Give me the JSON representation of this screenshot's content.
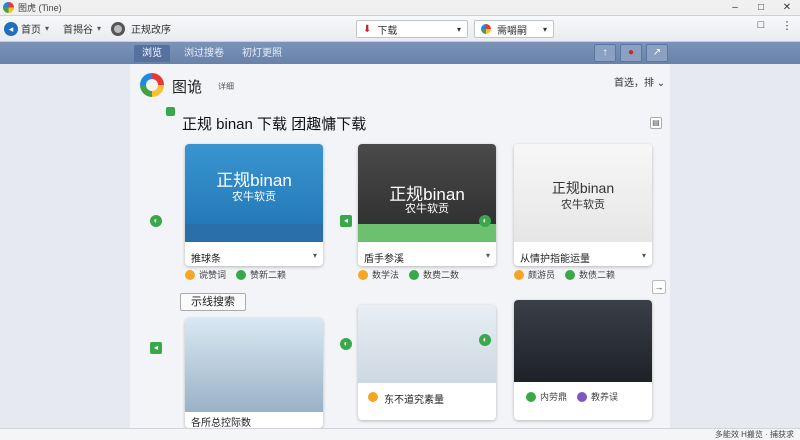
{
  "window": {
    "title": "图虎 (Tine)",
    "controls": [
      "–",
      "□",
      "✕"
    ]
  },
  "toolbar": {
    "home_label": "首页",
    "nav2_label": "首揭谷",
    "settings_label": "正规改序",
    "download_label": "下载",
    "profile_label": "需嚼嗣",
    "right_icons": [
      "□",
      "⋮"
    ]
  },
  "tabs": {
    "tab1": "浏览",
    "tab2": "浏过搜卷",
    "tab3": "初灯更照"
  },
  "header": {
    "title": "图诡",
    "subtitle": "详细",
    "sort_label": "首选，排 ⌄"
  },
  "section": {
    "title": "正规 binan 下载 团趣慵下载",
    "tag_label": "示线搜索"
  },
  "cards": [
    {
      "thumb_big": "正规binan",
      "thumb_small": "农牛软贡",
      "caption": "推球条",
      "meta_a": "谠赞词",
      "meta_b": "赞新二赖"
    },
    {
      "thumb_big": "正规binan",
      "thumb_small": "农牛软贡",
      "caption": "盾手参溪",
      "meta_a": "数学法",
      "meta_b": "数费二数"
    },
    {
      "thumb_big": "正规binan",
      "thumb_small": "农牛软贡",
      "caption": "从情护指能运量",
      "meta_a": "颇游员",
      "meta_b": "数债二赖"
    },
    {
      "caption": "各所总控际数"
    },
    {
      "caption": "东不道究素量"
    },
    {
      "caption": "内劳鼎",
      "meta_b": "教养误"
    }
  ],
  "status": {
    "text": "多能效 H搬览 · 捕获求"
  }
}
